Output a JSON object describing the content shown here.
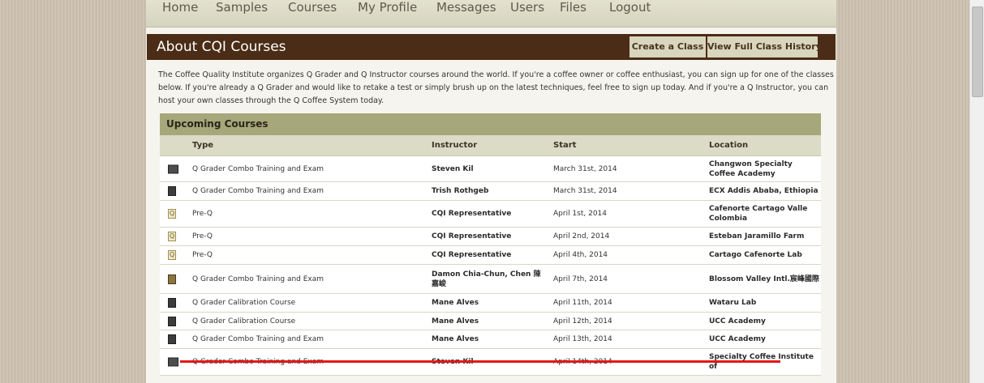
{
  "nav": {
    "items": [
      "Home",
      "Samples",
      "Courses",
      "My Profile",
      "Messages",
      "Users",
      "Files",
      "Logout"
    ]
  },
  "about": {
    "title": "About CQI Courses",
    "create_class": "Create a Class",
    "view_history": "View Full Class History"
  },
  "intro_text": "The Coffee Quality Institute organizes Q Grader and Q Instructor courses around the world. If you're a coffee owner or coffee enthusiast, you can sign up for one of the classes below. If you're already a Q Grader and would like to retake a test or simply brush up on the latest techniques, feel free to sign up today. And if you're a Q Instructor, you can host your own classes through the Q Coffee System today.",
  "upcoming": {
    "title": "Upcoming Courses",
    "columns": {
      "type": "Type",
      "instructor": "Instructor",
      "start": "Start",
      "location": "Location"
    },
    "rows": [
      {
        "icon": "photo-icon",
        "type": "Q Grader Combo Training and Exam",
        "instructor": "Steven Kil",
        "start": "March 31st, 2014",
        "location": "Changwon Specialty Coffee Academy"
      },
      {
        "icon": "portrait-icon",
        "type": "Q Grader Combo Training and Exam",
        "instructor": "Trish Rothgeb",
        "start": "March 31st, 2014",
        "location": "ECX Addis Ababa, Ethiopia"
      },
      {
        "icon": "q-badge-icon",
        "type": "Pre-Q",
        "instructor": "CQI Representative",
        "start": "April 1st, 2014",
        "location": "Cafenorte Cartago Valle Colombia"
      },
      {
        "icon": "q-badge-icon",
        "type": "Pre-Q",
        "instructor": "CQI Representative",
        "start": "April 2nd, 2014",
        "location": "Esteban Jaramillo Farm"
      },
      {
        "icon": "q-badge-icon",
        "type": "Pre-Q",
        "instructor": "CQI Representative",
        "start": "April 4th, 2014",
        "location": "Cartago Cafenorte Lab"
      },
      {
        "icon": "book-icon",
        "type": "Q Grader Combo Training and Exam",
        "instructor": "Damon Chia-Chun, Chen 陳嘉峻",
        "start": "April 7th, 2014",
        "location": "Blossom Valley Intl.宸峰國際"
      },
      {
        "icon": "portrait-icon",
        "type": "Q Grader Calibration Course",
        "instructor": "Mane Alves",
        "start": "April 11th, 2014",
        "location": "Wataru Lab"
      },
      {
        "icon": "portrait-icon",
        "type": "Q Grader Calibration Course",
        "instructor": "Mane Alves",
        "start": "April 12th, 2014",
        "location": "UCC Academy"
      },
      {
        "icon": "portrait-icon",
        "type": "Q Grader Combo Training and Exam",
        "instructor": "Mane Alves",
        "start": "April 13th, 2014",
        "location": "UCC Academy"
      },
      {
        "icon": "photo-icon",
        "type": "Q Grader Combo Training and Exam",
        "instructor": "Steven Kil",
        "start": "April 14th, 2014",
        "location": "Specialty Coffee Institute of"
      }
    ]
  },
  "colors": {
    "header_brown": "#4b2c16",
    "section_green": "#a6a87b",
    "highlight_red": "#e51717"
  }
}
